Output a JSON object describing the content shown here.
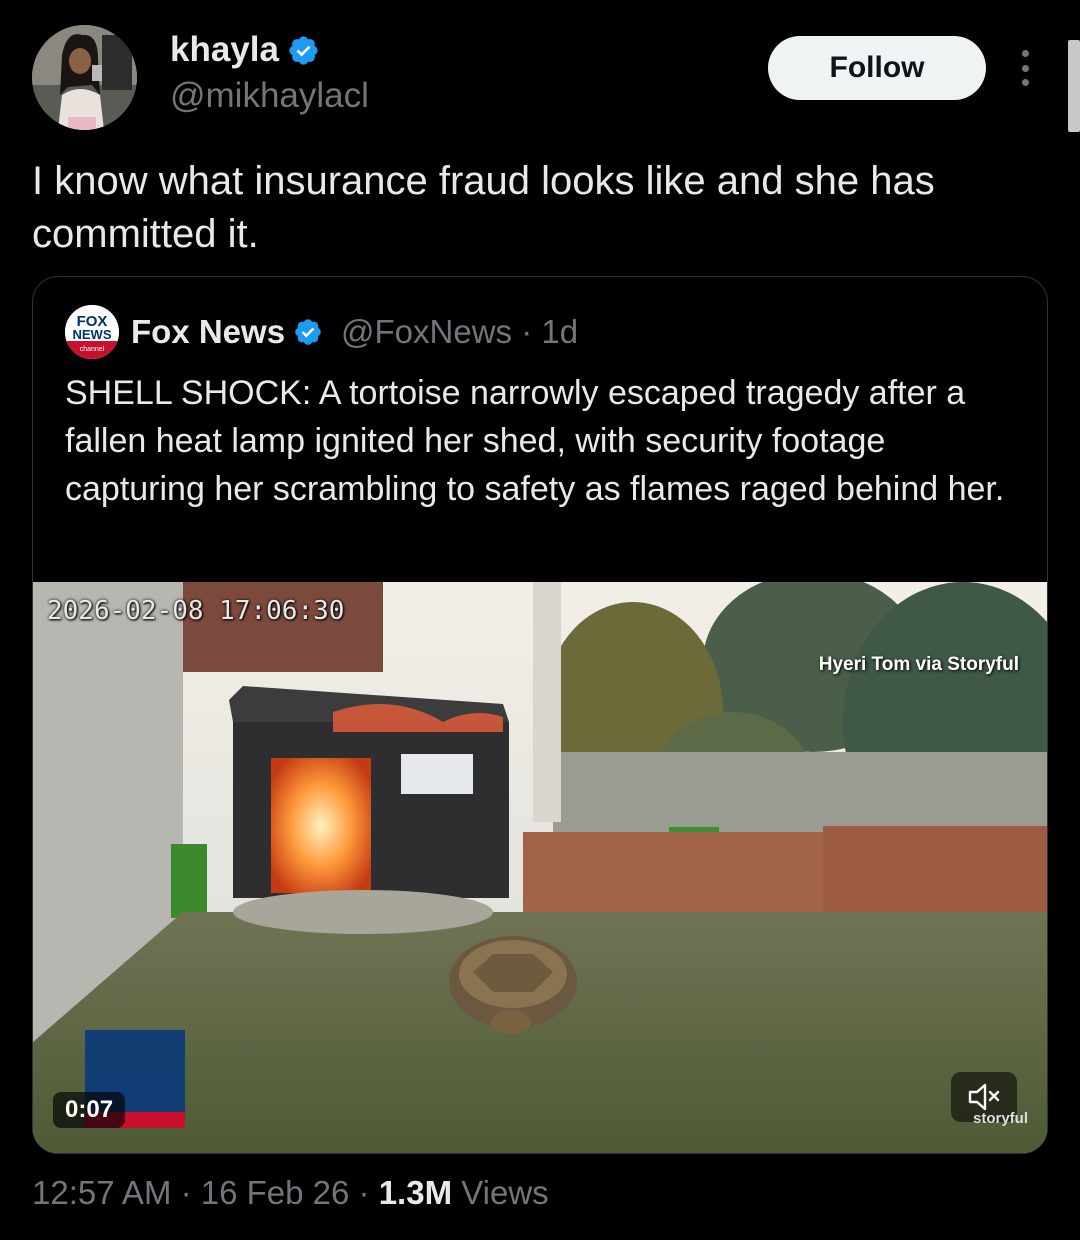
{
  "author": {
    "display_name": "khayla",
    "handle": "@mikhaylacl",
    "verified_icon": "verified-badge-icon",
    "follow_label": "Follow"
  },
  "tweet": {
    "text": "I know what insurance fraud looks like and she has committed it."
  },
  "quoted": {
    "display_name": "Fox News",
    "handle_and_time": "@FoxNews · 1d",
    "text": "SHELL SHOCK: A tortoise narrowly escaped tragedy after a fallen heat lamp ignited her shed, with security footage capturing her scrambling to safety as flames raged behind her.",
    "logo_text": {
      "line1": "FOX",
      "line2": "NEWS",
      "line3": "channel"
    },
    "video": {
      "camera_timestamp": "2026-02-08 17:06:30",
      "credit": "Hyeri Tom via Storyful",
      "duration": "0:07",
      "watermark": "storyful",
      "mute_icon": "volume-muted-icon"
    }
  },
  "meta": {
    "time_date": "12:57 AM · 16 Feb 26 · ",
    "views_count": "1.3M",
    "views_label": " Views"
  },
  "colors": {
    "background": "#000000",
    "text_primary": "#e7e9ea",
    "text_secondary": "#71767b",
    "verified_blue": "#1d9bf0",
    "border": "#2f3336"
  }
}
